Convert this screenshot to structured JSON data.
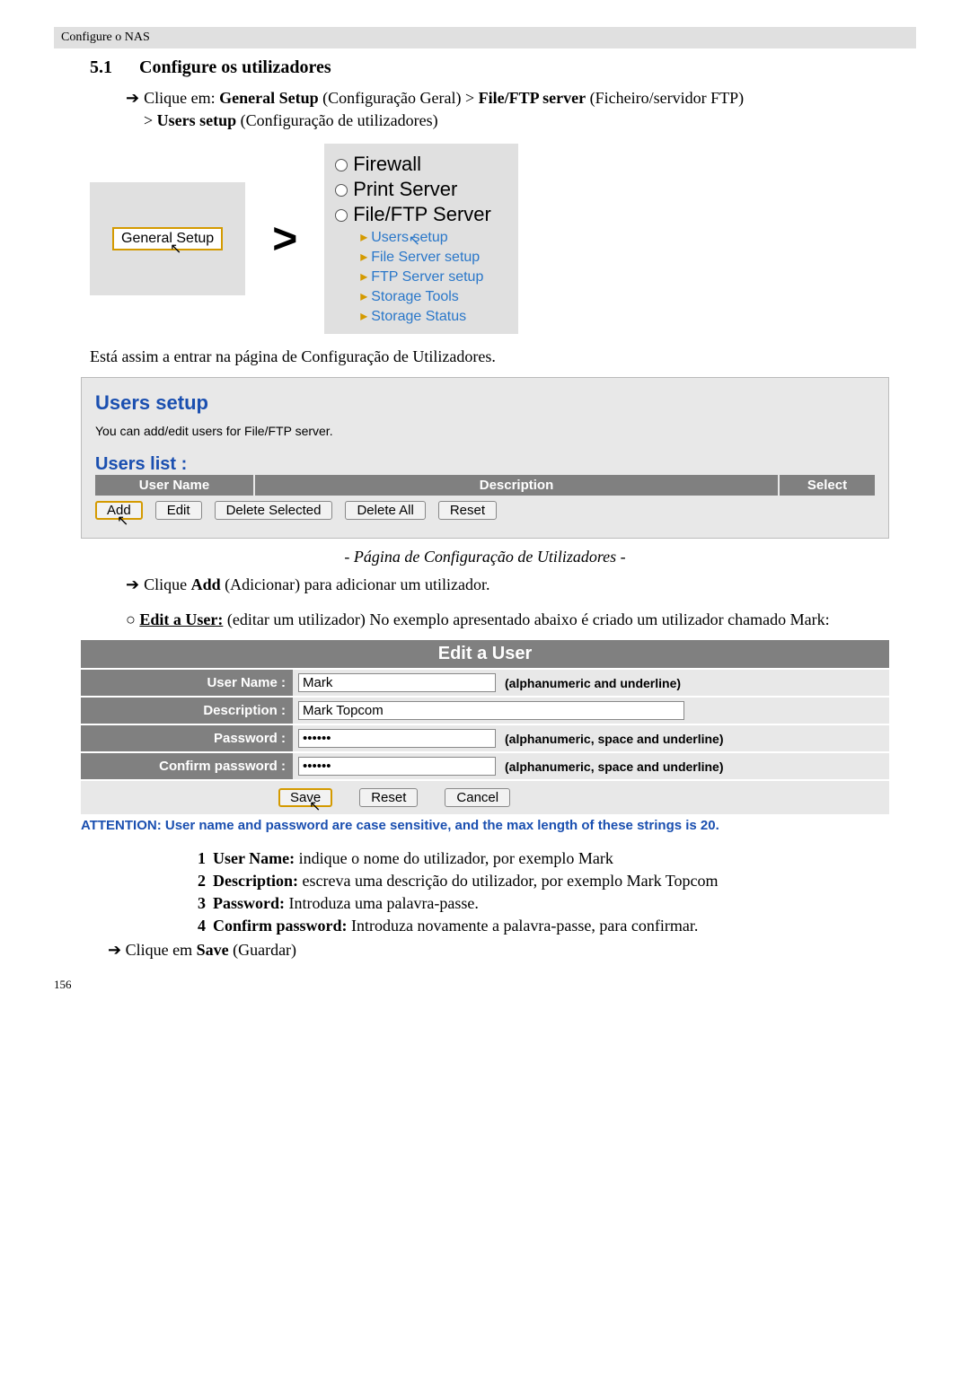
{
  "header": "Configure o NAS",
  "section_number": "5.1",
  "section_title": "Configure os utilizadores",
  "intro_line1_pre": "Clique em: ",
  "intro_general_setup": "General Setup",
  "intro_general_setup_paren": " (Configuração Geral) > ",
  "intro_fileftp": "File/FTP server",
  "intro_fileftp_paren": " (Ficheiro/servidor FTP)",
  "intro_line2_pre": "> ",
  "intro_users_setup": "Users setup",
  "intro_users_setup_paren": " (Configuração de utilizadores)",
  "nav": {
    "general_setup": "General Setup",
    "cats": [
      "Firewall",
      "Print Server",
      "File/FTP Server"
    ],
    "subs": [
      "Users setup",
      "File Server setup",
      "FTP Server setup",
      "Storage Tools",
      "Storage Status"
    ]
  },
  "entering_text": "Está assim a entrar na página de Configuração de Utilizadores.",
  "users_panel": {
    "title": "Users setup",
    "subtitle": "You can add/edit users for File/FTP server.",
    "list_title": "Users list  :",
    "cols": {
      "user": "User Name",
      "desc": "Description",
      "sel": "Select"
    },
    "buttons": {
      "add": "Add",
      "edit": "Edit",
      "del_sel": "Delete Selected",
      "del_all": "Delete All",
      "reset": "Reset"
    }
  },
  "caption1": "- Página de Configuração de Utilizadores -",
  "click_add_pre": "Clique ",
  "click_add_bold": "Add",
  "click_add_post": " (Adicionar) para adicionar um utilizador.",
  "edit_user_intro_bold": "Edit a User:",
  "edit_user_intro_rest": " (editar um utilizador) No exemplo apresentado abaixo é criado um utilizador chamado Mark:",
  "edit_panel": {
    "header": "Edit a User",
    "rows": {
      "username_label": "User Name  :",
      "username_value": "Mark",
      "username_hint": "(alphanumeric and underline)",
      "description_label": "Description  :",
      "description_value": "Mark Topcom",
      "password_label": "Password  :",
      "password_value": "••••••",
      "password_hint": "(alphanumeric, space and underline)",
      "confirm_label": "Confirm password  :",
      "confirm_value": "••••••",
      "confirm_hint": "(alphanumeric, space and underline)"
    },
    "buttons": {
      "save": "Save",
      "reset": "Reset",
      "cancel": "Cancel"
    }
  },
  "attention": "ATTENTION: User name and password are case sensitive, and the max length of these strings is 20.",
  "numbered": [
    {
      "n": "1",
      "b": "User Name:",
      "t": " indique o nome do utilizador, por exemplo Mark"
    },
    {
      "n": "2",
      "b": "Description:",
      "t": " escreva uma descrição do utilizador, por exemplo Mark Topcom"
    },
    {
      "n": "3",
      "b": "Password:",
      "t": " Introduza uma palavra-passe."
    },
    {
      "n": "4",
      "b": "Confirm password:",
      "t": " Introduza novamente a palavra-passe, para confirmar."
    }
  ],
  "click_save_pre": "Clique em ",
  "click_save_bold": "Save",
  "click_save_post": " (Guardar)",
  "page_number": "156"
}
